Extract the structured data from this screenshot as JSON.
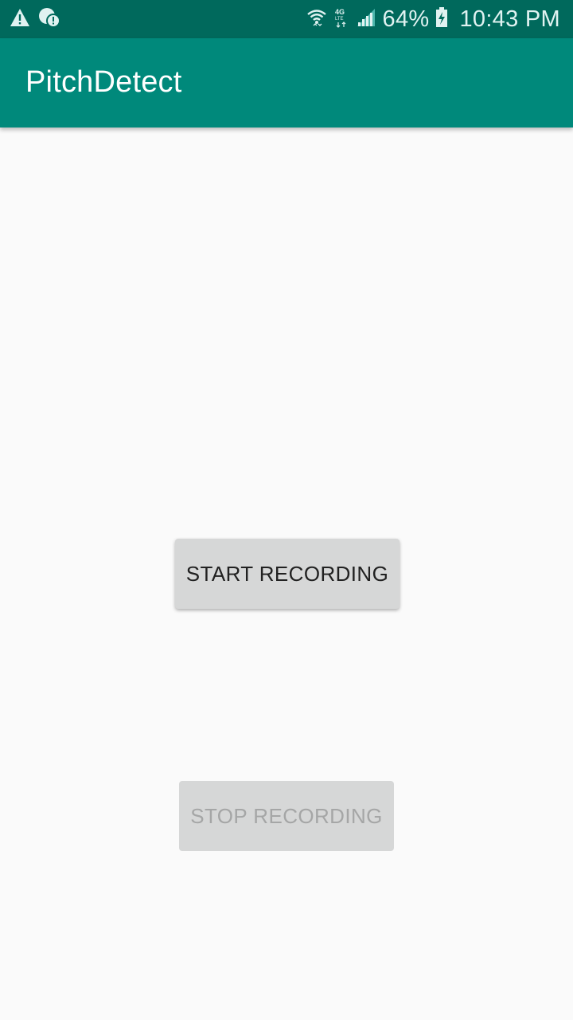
{
  "status_bar": {
    "left_icons": [
      "warning-icon",
      "alert-notification-icon"
    ],
    "right_icons": [
      "wifi-icon",
      "lte-icon",
      "signal-icon",
      "battery-charging-icon"
    ],
    "battery": "64%",
    "time": "10:43 PM"
  },
  "app_bar": {
    "title": "PitchDetect"
  },
  "main": {
    "start_button_label": "START RECORDING",
    "stop_button_label": "STOP RECORDING",
    "stop_button_enabled": false
  },
  "colors": {
    "status_bar": "#00695c",
    "app_bar": "#00897b",
    "background": "#fafafa",
    "button": "#d6d7d7"
  }
}
